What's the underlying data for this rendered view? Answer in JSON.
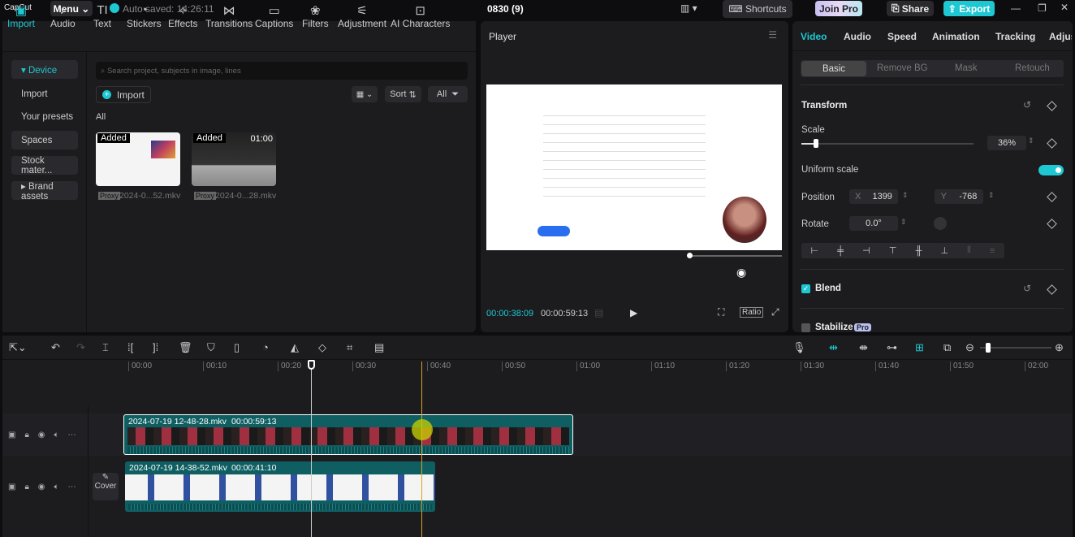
{
  "app": {
    "logo": "CapCut",
    "menu": "Menu",
    "autosave": "Auto saved: 14:26:11",
    "project_title": "0830 (9)",
    "shortcuts": "Shortcuts",
    "join_pro": "Join Pro",
    "share": "Share",
    "export": "Export",
    "accent": "#1ec8d2"
  },
  "toolbar": [
    {
      "label": "Import",
      "icon": "▣"
    },
    {
      "label": "Audio",
      "icon": "♪"
    },
    {
      "label": "Text",
      "icon": "TI"
    },
    {
      "label": "Stickers",
      "icon": "◔"
    },
    {
      "label": "Effects",
      "icon": "✧"
    },
    {
      "label": "Transitions",
      "icon": "⋈"
    },
    {
      "label": "Captions",
      "icon": "▭"
    },
    {
      "label": "Filters",
      "icon": "❀"
    },
    {
      "label": "Adjustment",
      "icon": "⚟"
    },
    {
      "label": "AI Characters",
      "icon": "⊡"
    }
  ],
  "sidebar": [
    {
      "label": "▾ Device"
    },
    {
      "label": "Import"
    },
    {
      "label": "Your presets"
    },
    {
      "label": "Spaces"
    },
    {
      "label": "Stock mater..."
    },
    {
      "label": "▸ Brand assets"
    }
  ],
  "media": {
    "search_placeholder": "Search project, subjects in image, lines",
    "import": "Import",
    "sort": "Sort",
    "filter": "All",
    "section": "All",
    "items": [
      {
        "badge": "Added",
        "proxy": "Proxy",
        "name": "2024-0...52.mkv",
        "duration": ""
      },
      {
        "badge": "Added",
        "proxy": "Proxy",
        "name": "2024-0...28.mkv",
        "duration": "01:00"
      }
    ]
  },
  "player": {
    "title": "Player",
    "current": "00:00:38:09",
    "total": "00:00:59:13",
    "ratio": "Ratio"
  },
  "props": {
    "tabs": [
      "Video",
      "Audio",
      "Speed",
      "Animation",
      "Tracking",
      "Adjus"
    ],
    "subtabs": [
      "Basic",
      "Remove BG",
      "Mask",
      "Retouch"
    ],
    "transform": "Transform",
    "scale_label": "Scale",
    "scale": "36%",
    "scale_value": 0.36,
    "uniform": "Uniform scale",
    "uniform_on": true,
    "position": "Position",
    "x_label": "X",
    "x": "1399",
    "y_label": "Y",
    "y": "-768",
    "rotate": "Rotate",
    "rotate_val": "0.0°",
    "blend": "Blend",
    "stabilize": "Stabilize",
    "pro": "Pro"
  },
  "timeline": {
    "ticks": [
      "00:00",
      "00:10",
      "00:20",
      "00:30",
      "00:40",
      "00:50",
      "01:00",
      "01:10",
      "01:20",
      "01:30",
      "01:40",
      "01:50",
      "02:00"
    ],
    "cover": "Cover",
    "clips": [
      {
        "name": "2024-07-19 12-48-28.mkv",
        "duration": "00:00:59:13"
      },
      {
        "name": "2024-07-19 14-38-52.mkv",
        "duration": "00:00:41:10"
      }
    ]
  }
}
